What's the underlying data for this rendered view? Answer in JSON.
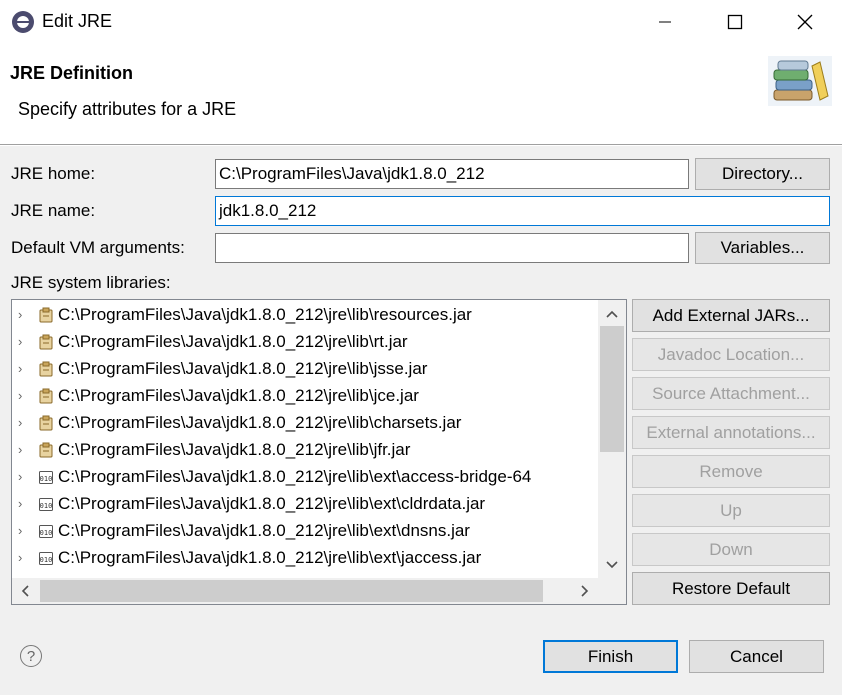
{
  "window": {
    "title": "Edit JRE",
    "minimize_icon": "minimize-icon",
    "maximize_icon": "maximize-icon",
    "close_icon": "close-icon"
  },
  "header": {
    "title": "JRE Definition",
    "subtitle": "Specify attributes for a JRE",
    "icon": "library-books-icon"
  },
  "form": {
    "jre_home_label": "JRE home:",
    "jre_home_value": "C:\\ProgramFiles\\Java\\jdk1.8.0_212",
    "directory_button": "Directory...",
    "jre_name_label": "JRE name:",
    "jre_name_value": "jdk1.8.0_212",
    "vm_args_label": "Default VM arguments:",
    "vm_args_value": "",
    "variables_button": "Variables...",
    "libraries_label": "JRE system libraries:"
  },
  "libraries": [
    {
      "path": "C:\\ProgramFiles\\Java\\jdk1.8.0_212\\jre\\lib\\resources.jar",
      "icon": "jar-icon"
    },
    {
      "path": "C:\\ProgramFiles\\Java\\jdk1.8.0_212\\jre\\lib\\rt.jar",
      "icon": "jar-icon"
    },
    {
      "path": "C:\\ProgramFiles\\Java\\jdk1.8.0_212\\jre\\lib\\jsse.jar",
      "icon": "jar-icon"
    },
    {
      "path": "C:\\ProgramFiles\\Java\\jdk1.8.0_212\\jre\\lib\\jce.jar",
      "icon": "jar-icon"
    },
    {
      "path": "C:\\ProgramFiles\\Java\\jdk1.8.0_212\\jre\\lib\\charsets.jar",
      "icon": "jar-icon"
    },
    {
      "path": "C:\\ProgramFiles\\Java\\jdk1.8.0_212\\jre\\lib\\jfr.jar",
      "icon": "jar-icon"
    },
    {
      "path": "C:\\ProgramFiles\\Java\\jdk1.8.0_212\\jre\\lib\\ext\\access-bridge-64",
      "icon": "binary-jar-icon"
    },
    {
      "path": "C:\\ProgramFiles\\Java\\jdk1.8.0_212\\jre\\lib\\ext\\cldrdata.jar",
      "icon": "binary-jar-icon"
    },
    {
      "path": "C:\\ProgramFiles\\Java\\jdk1.8.0_212\\jre\\lib\\ext\\dnsns.jar",
      "icon": "binary-jar-icon"
    },
    {
      "path": "C:\\ProgramFiles\\Java\\jdk1.8.0_212\\jre\\lib\\ext\\jaccess.jar",
      "icon": "binary-jar-icon"
    }
  ],
  "side_buttons": {
    "add_external_jars": "Add External JARs...",
    "javadoc_location": "Javadoc Location...",
    "source_attachment": "Source Attachment...",
    "external_annotations": "External annotations...",
    "remove": "Remove",
    "up": "Up",
    "down": "Down",
    "restore_default": "Restore Default"
  },
  "footer": {
    "help_symbol": "?",
    "finish_button": "Finish",
    "cancel_button": "Cancel"
  },
  "colors": {
    "accent": "#0078d7",
    "disabled_text": "#a0a0a0"
  }
}
